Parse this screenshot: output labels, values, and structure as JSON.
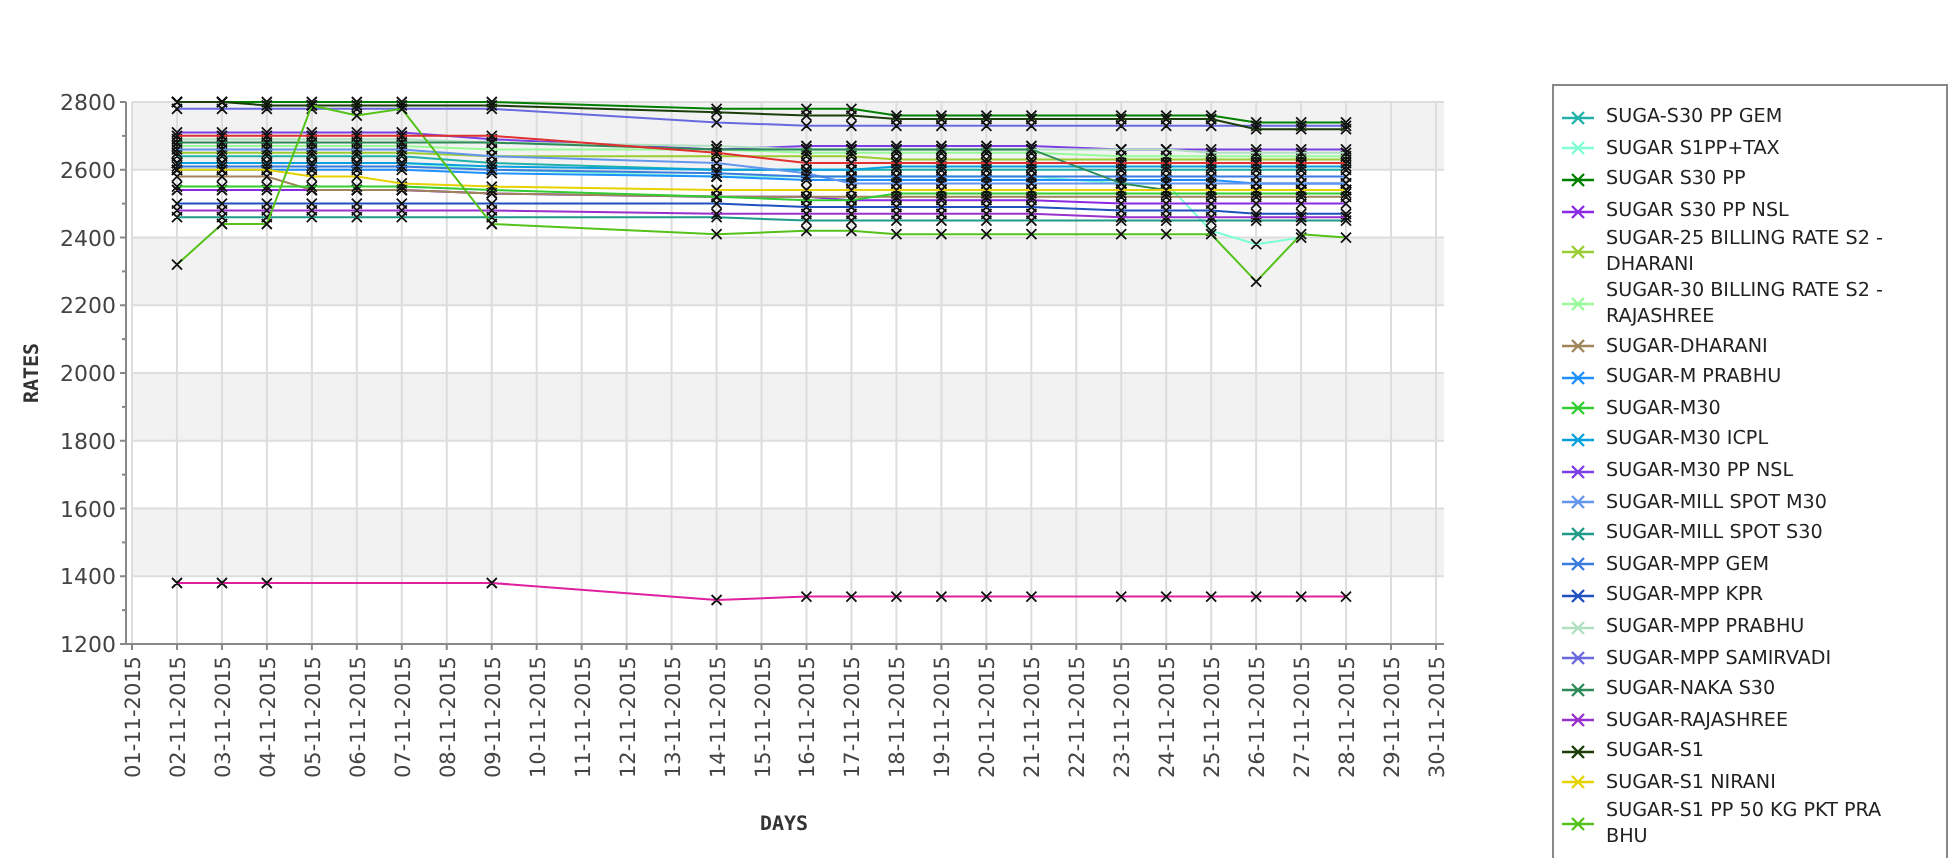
{
  "chart": {
    "chart_data": {
      "type": "line",
      "grid": true,
      "xlabel": "DAYS",
      "ylabel": "RATES",
      "ylim": [
        1200,
        2800
      ],
      "yticks": [
        1200,
        1400,
        1600,
        1800,
        2000,
        2200,
        2400,
        2600,
        2800
      ],
      "categories": [
        "01-11-2015",
        "02-11-2015",
        "03-11-2015",
        "04-11-2015",
        "05-11-2015",
        "06-11-2015",
        "07-11-2015",
        "08-11-2015",
        "09-11-2015",
        "10-11-2015",
        "11-11-2015",
        "12-11-2015",
        "13-11-2015",
        "14-11-2015",
        "15-11-2015",
        "16-11-2015",
        "17-11-2015",
        "18-11-2015",
        "19-11-2015",
        "20-11-2015",
        "21-11-2015",
        "22-11-2015",
        "23-11-2015",
        "24-11-2015",
        "25-11-2015",
        "26-11-2015",
        "27-11-2015",
        "28-11-2015",
        "29-11-2015",
        "30-11-2015"
      ],
      "series": [
        {
          "name": "SUGA-S30 PP GEM",
          "marker": "x",
          "color": "#20b2aa",
          "values": [
            null,
            2640,
            2640,
            2640,
            2640,
            2640,
            2640,
            null,
            2620,
            null,
            null,
            null,
            null,
            2600,
            null,
            2600,
            2600,
            2600,
            2600,
            2600,
            2600,
            null,
            2600,
            2600,
            2600,
            2600,
            2600,
            2600,
            null,
            null
          ]
        },
        {
          "name": "SUGAR S1PP+TAX",
          "marker": "x",
          "color": "#7fffd4",
          "values": [
            null,
            2620,
            2620,
            2620,
            2620,
            2620,
            2620,
            null,
            2600,
            null,
            null,
            null,
            null,
            2580,
            null,
            2580,
            2580,
            2580,
            2580,
            2580,
            2580,
            null,
            2560,
            2560,
            2420,
            2380,
            2400,
            null,
            null,
            null
          ]
        },
        {
          "name": "SUGAR S30 PP",
          "marker": "x",
          "color": "#008000",
          "values": [
            null,
            2800,
            2800,
            2800,
            2800,
            2800,
            2800,
            null,
            2800,
            null,
            null,
            null,
            null,
            2780,
            null,
            2780,
            2780,
            2760,
            2760,
            2760,
            2760,
            null,
            2760,
            2760,
            2760,
            2740,
            2740,
            2740,
            null,
            null
          ]
        },
        {
          "name": "SUGAR S30 PP NSL",
          "marker": "x",
          "color": "#8a2be2",
          "values": [
            null,
            2540,
            2540,
            2540,
            2540,
            2540,
            2540,
            null,
            2530,
            null,
            null,
            null,
            null,
            2520,
            null,
            2520,
            2510,
            2510,
            2510,
            2510,
            2510,
            null,
            2500,
            2500,
            2500,
            2500,
            2500,
            2500,
            null,
            null
          ]
        },
        {
          "name": "SUGAR-25 BILLING RATE S2 -DHARANI",
          "marker": "x",
          "color": "#9acd32",
          "values": [
            null,
            2650,
            2650,
            2650,
            2650,
            2650,
            2650,
            null,
            2640,
            null,
            null,
            null,
            null,
            2640,
            null,
            2640,
            2640,
            2630,
            2630,
            2630,
            2630,
            null,
            2630,
            2630,
            2630,
            2630,
            2630,
            2630,
            null,
            null
          ]
        },
        {
          "name": "SUGAR-30 BILLING RATE S2 -RAJASHREE",
          "marker": "x",
          "color": "#98fb98",
          "values": [
            null,
            2670,
            2670,
            2670,
            2670,
            2670,
            2670,
            null,
            2660,
            null,
            null,
            null,
            null,
            2660,
            null,
            2650,
            2650,
            2650,
            2650,
            2650,
            2650,
            null,
            2640,
            2640,
            2640,
            2640,
            2640,
            2640,
            null,
            null
          ]
        },
        {
          "name": "SUGAR-DHARANI",
          "marker": "x",
          "color": "#a0855b",
          "values": [
            null,
            2580,
            2580,
            2580,
            2540,
            2540,
            2540,
            null,
            2530,
            null,
            null,
            null,
            null,
            2520,
            null,
            2520,
            2520,
            2520,
            2520,
            2520,
            2520,
            null,
            2520,
            2520,
            2520,
            2520,
            2520,
            2520,
            null,
            null
          ]
        },
        {
          "name": "SUGAR-M PRABHU",
          "marker": "x",
          "color": "#1e90ff",
          "values": [
            null,
            2600,
            2600,
            2600,
            2600,
            2600,
            2600,
            null,
            2590,
            null,
            null,
            null,
            null,
            2580,
            null,
            2570,
            2570,
            2570,
            2570,
            2570,
            2570,
            null,
            2570,
            2570,
            2570,
            2560,
            2560,
            2560,
            null,
            null
          ]
        },
        {
          "name": "SUGAR-M30",
          "marker": "x",
          "color": "#32cd32",
          "values": [
            null,
            2550,
            2550,
            2550,
            2550,
            2550,
            2550,
            null,
            2540,
            null,
            null,
            null,
            null,
            2520,
            null,
            2510,
            2510,
            2530,
            2530,
            2530,
            2530,
            null,
            2530,
            2530,
            2530,
            2530,
            2530,
            2530,
            null,
            null
          ]
        },
        {
          "name": "SUGAR-M30 ICPL",
          "marker": "x",
          "color": "#0aa0e0",
          "values": [
            null,
            2620,
            2620,
            2620,
            2620,
            2620,
            2620,
            null,
            2610,
            null,
            null,
            null,
            null,
            2600,
            null,
            2600,
            2600,
            2610,
            2610,
            2610,
            2610,
            null,
            2610,
            2610,
            2610,
            2610,
            2610,
            2610,
            null,
            null
          ]
        },
        {
          "name": "SUGAR-M30 PP NSL",
          "marker": "x",
          "color": "#7b3fe4",
          "values": [
            null,
            2710,
            2710,
            2710,
            2710,
            2710,
            2710,
            null,
            2690,
            null,
            null,
            null,
            null,
            2660,
            null,
            2670,
            2670,
            2670,
            2670,
            2670,
            2670,
            null,
            2660,
            2660,
            2660,
            2660,
            2660,
            2660,
            null,
            null
          ]
        },
        {
          "name": "SUGAR-MILL SPOT M30",
          "marker": "x",
          "color": "#6495ed",
          "values": [
            null,
            2660,
            2660,
            2660,
            2660,
            2660,
            2660,
            null,
            2640,
            null,
            null,
            null,
            null,
            2620,
            null,
            2590,
            2560,
            2560,
            2560,
            2560,
            2560,
            null,
            2560,
            2560,
            2560,
            2560,
            2560,
            2560,
            null,
            null
          ]
        },
        {
          "name": "SUGAR-MILL SPOT S30",
          "marker": "x",
          "color": "#1f9a8a",
          "values": [
            null,
            2460,
            2460,
            2460,
            2460,
            2460,
            2460,
            null,
            2460,
            null,
            null,
            null,
            null,
            2460,
            null,
            2450,
            2450,
            2450,
            2450,
            2450,
            2450,
            null,
            2450,
            2450,
            2450,
            2450,
            2450,
            2450,
            null,
            null
          ]
        },
        {
          "name": "SUGAR-MPP GEM",
          "marker": "x",
          "color": "#3a7be0",
          "values": [
            null,
            2610,
            2610,
            2610,
            2610,
            2610,
            2610,
            null,
            2600,
            null,
            null,
            null,
            null,
            2590,
            null,
            2580,
            2580,
            2580,
            2580,
            2580,
            2580,
            null,
            2580,
            2580,
            2580,
            2580,
            2580,
            2580,
            null,
            null
          ]
        },
        {
          "name": "SUGAR-MPP KPR",
          "marker": "x",
          "color": "#2050c0",
          "values": [
            null,
            2500,
            2500,
            2500,
            2500,
            2500,
            2500,
            null,
            2500,
            null,
            null,
            null,
            null,
            2500,
            null,
            2490,
            2490,
            2490,
            2490,
            2490,
            2490,
            null,
            2480,
            2480,
            2480,
            2470,
            2470,
            2470,
            null,
            null
          ]
        },
        {
          "name": "SUGAR-MPP PRABHU",
          "marker": "x",
          "color": "#b0e0c0",
          "values": [
            null,
            2690,
            2690,
            2690,
            2690,
            2690,
            2690,
            null,
            2680,
            null,
            null,
            null,
            null,
            2670,
            null,
            2660,
            2660,
            2660,
            2660,
            2660,
            2660,
            null,
            2660,
            2660,
            2650,
            2650,
            2650,
            2650,
            null,
            null
          ]
        },
        {
          "name": "SUGAR-MPP SAMIRVADI",
          "marker": "x",
          "color": "#6a6ae0",
          "values": [
            null,
            2780,
            2780,
            2780,
            2780,
            2780,
            2780,
            null,
            2780,
            null,
            null,
            null,
            null,
            2740,
            null,
            2730,
            2730,
            2730,
            2730,
            2730,
            2730,
            null,
            2730,
            2730,
            2730,
            2730,
            2730,
            2730,
            null,
            null
          ]
        },
        {
          "name": "SUGAR-NAKA S30",
          "marker": "x",
          "color": "#2e8b57",
          "values": [
            null,
            2680,
            2680,
            2680,
            2680,
            2680,
            2680,
            null,
            2680,
            null,
            null,
            null,
            null,
            2660,
            null,
            2660,
            2660,
            2660,
            2660,
            2660,
            2660,
            null,
            2560,
            2540,
            2540,
            2540,
            2540,
            2540,
            null,
            null
          ]
        },
        {
          "name": "SUGAR-RAJASHREE",
          "marker": "x",
          "color": "#9932cc",
          "values": [
            null,
            2480,
            2480,
            2480,
            2480,
            2480,
            2480,
            null,
            2480,
            null,
            null,
            null,
            null,
            2470,
            null,
            2470,
            2470,
            2470,
            2470,
            2470,
            2470,
            null,
            2460,
            2460,
            2460,
            2460,
            2460,
            2460,
            null,
            null
          ]
        },
        {
          "name": "SUGAR-S1",
          "marker": "x",
          "color": "#1a3d0a",
          "values": [
            null,
            2800,
            2800,
            2790,
            2790,
            2790,
            2790,
            null,
            2790,
            null,
            null,
            null,
            null,
            2770,
            null,
            2760,
            2760,
            2750,
            2750,
            2750,
            2750,
            null,
            2750,
            2750,
            2750,
            2720,
            2720,
            2720,
            null,
            null
          ]
        },
        {
          "name": "SUGAR-S1 NIRANI",
          "marker": "x",
          "color": "#e6d200",
          "values": [
            null,
            2600,
            2600,
            2600,
            2580,
            2580,
            2560,
            null,
            2550,
            null,
            null,
            null,
            null,
            2540,
            null,
            2540,
            2540,
            2540,
            2540,
            2540,
            2540,
            null,
            2540,
            2540,
            2540,
            2540,
            2540,
            2540,
            null,
            null
          ]
        },
        {
          "name": "SUGAR-S1 PP 50 KG PKT PRA BHU",
          "marker": "x",
          "color": "#55c21b",
          "values": [
            null,
            2320,
            2440,
            2440,
            2790,
            2760,
            2780,
            null,
            2440,
            null,
            null,
            null,
            null,
            2410,
            null,
            2420,
            2420,
            2410,
            2410,
            2410,
            2410,
            null,
            2410,
            2410,
            2410,
            2270,
            2410,
            2400,
            null,
            null
          ]
        },
        {
          "color": "#e020a0",
          "marker": "x",
          "values": [
            null,
            1380,
            1380,
            1380,
            null,
            null,
            null,
            null,
            1380,
            null,
            null,
            null,
            null,
            1330,
            null,
            1340,
            1340,
            1340,
            1340,
            1340,
            1340,
            null,
            1340,
            1340,
            1340,
            1340,
            1340,
            1340,
            null,
            null
          ]
        },
        {
          "color": "#e03030",
          "marker": "x",
          "values": [
            null,
            2700,
            2700,
            2700,
            2700,
            2700,
            2700,
            null,
            2700,
            null,
            null,
            null,
            null,
            2650,
            null,
            2620,
            2620,
            2620,
            2620,
            2620,
            2620,
            null,
            2620,
            2620,
            2620,
            2620,
            2620,
            2620,
            null,
            null
          ]
        }
      ]
    }
  }
}
